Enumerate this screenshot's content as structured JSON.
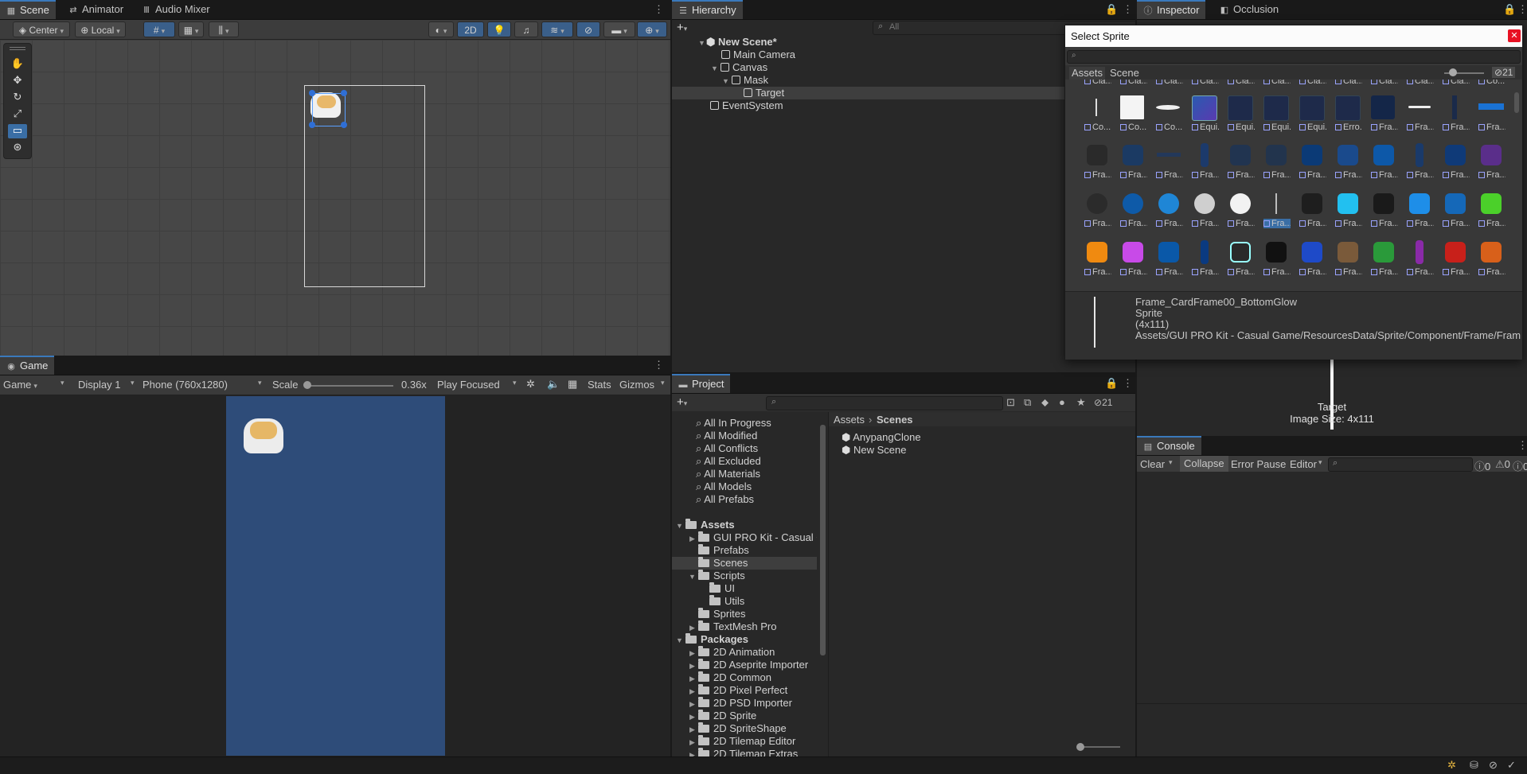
{
  "scene": {
    "tabs": [
      "Scene",
      "Animator",
      "Audio Mixer"
    ],
    "toolbar": {
      "pivot": "Center",
      "space": "Local",
      "mode2d": "2D"
    }
  },
  "game": {
    "tab": "Game",
    "toolbar": {
      "view": "Game",
      "display": "Display 1",
      "resolution": "Phone (760x1280)",
      "scale_label": "Scale",
      "scale_value": "0.36x",
      "play_mode": "Play Focused",
      "stats": "Stats",
      "gizmos": "Gizmos"
    }
  },
  "hierarchy": {
    "tab": "Hierarchy",
    "search_placeholder": "All",
    "items": [
      {
        "label": "New Scene*"
      },
      {
        "label": "Main Camera"
      },
      {
        "label": "Canvas"
      },
      {
        "label": "Mask"
      },
      {
        "label": "Target"
      },
      {
        "label": "EventSystem"
      }
    ]
  },
  "inspector": {
    "tabs": [
      "Inspector",
      "Occlusion"
    ],
    "preview_name": "Target",
    "preview_size": "Image Size: 4x111"
  },
  "select_sprite": {
    "title": "Select Sprite",
    "tabs": [
      "Assets",
      "Scene"
    ],
    "count": "21",
    "row0_labels": [
      "Cla...",
      "Cla...",
      "Cla...",
      "Cla...",
      "Cla...",
      "Cla...",
      "Cla...",
      "Cla...",
      "Cla...",
      "Cla...",
      "Cla...",
      "Co..."
    ],
    "row1_labels": [
      "Co...",
      "Co...",
      "Co...",
      "Equi...",
      "Equi...",
      "Equi...",
      "Equi...",
      "Erro...",
      "Fra...",
      "Fra...",
      "Fra...",
      "Fra..."
    ],
    "fra_label": "Fra...",
    "selected": {
      "name": "Frame_CardFrame00_BottomGlow",
      "type": "Sprite",
      "size": "(4x111)",
      "path": "Assets/GUI PRO Kit - Casual Game/ResourcesData/Sprite/Component/Frame/Frame_C"
    },
    "colors": {
      "row2": [
        "#2a2a2a",
        "#1b3a63",
        "#23385a",
        "#1c3a6b",
        "#213450",
        "#22344d",
        "#0b3a76",
        "#1a4a8c",
        "#0d58a8",
        "#1a3a6a",
        "#0f3a78",
        "#5a2e8a"
      ],
      "row3": [
        "#2b2b2b",
        "#0e5aa8",
        "#1f86d6",
        "#cfcfcf",
        "#f2f2f2",
        "#bcbcbc",
        "#1e1e1e",
        "#22c0f0",
        "#1a1a1a",
        "#1e8ee8",
        "#1568b8",
        "#4bd02a"
      ],
      "row4": [
        "#f08a10",
        "#c84ae8",
        "#0a58a8",
        "#0a3a80",
        "#2a2a2a",
        "#111111",
        "#1e4ac8",
        "#7a5a3a",
        "#2a9a3a",
        "#8a2aa8",
        "#c8201a",
        "#d8601a"
      ]
    }
  },
  "project": {
    "tab": "Project",
    "count": "21",
    "favorites": [
      "All In Progress",
      "All Modified",
      "All Conflicts",
      "All Excluded",
      "All Materials",
      "All Models",
      "All Prefabs"
    ],
    "assets_root": "Assets",
    "assets": [
      "GUI PRO Kit - Casual Ga",
      "Prefabs",
      "Scenes",
      "Scripts",
      "UI",
      "Utils",
      "Sprites",
      "TextMesh Pro"
    ],
    "packages_root": "Packages",
    "packages": [
      "2D Animation",
      "2D Aseprite Importer",
      "2D Common",
      "2D Pixel Perfect",
      "2D PSD Importer",
      "2D Sprite",
      "2D SpriteShape",
      "2D Tilemap Editor",
      "2D Tilemap Extras"
    ],
    "breadcrumb": [
      "Assets",
      "Scenes"
    ],
    "files": [
      "AnypangClone",
      "New Scene"
    ]
  },
  "console": {
    "tab": "Console",
    "clear": "Clear",
    "collapse": "Collapse",
    "error_pause": "Error Pause",
    "editor": "Editor",
    "counts": [
      "0",
      "0",
      "0"
    ]
  }
}
